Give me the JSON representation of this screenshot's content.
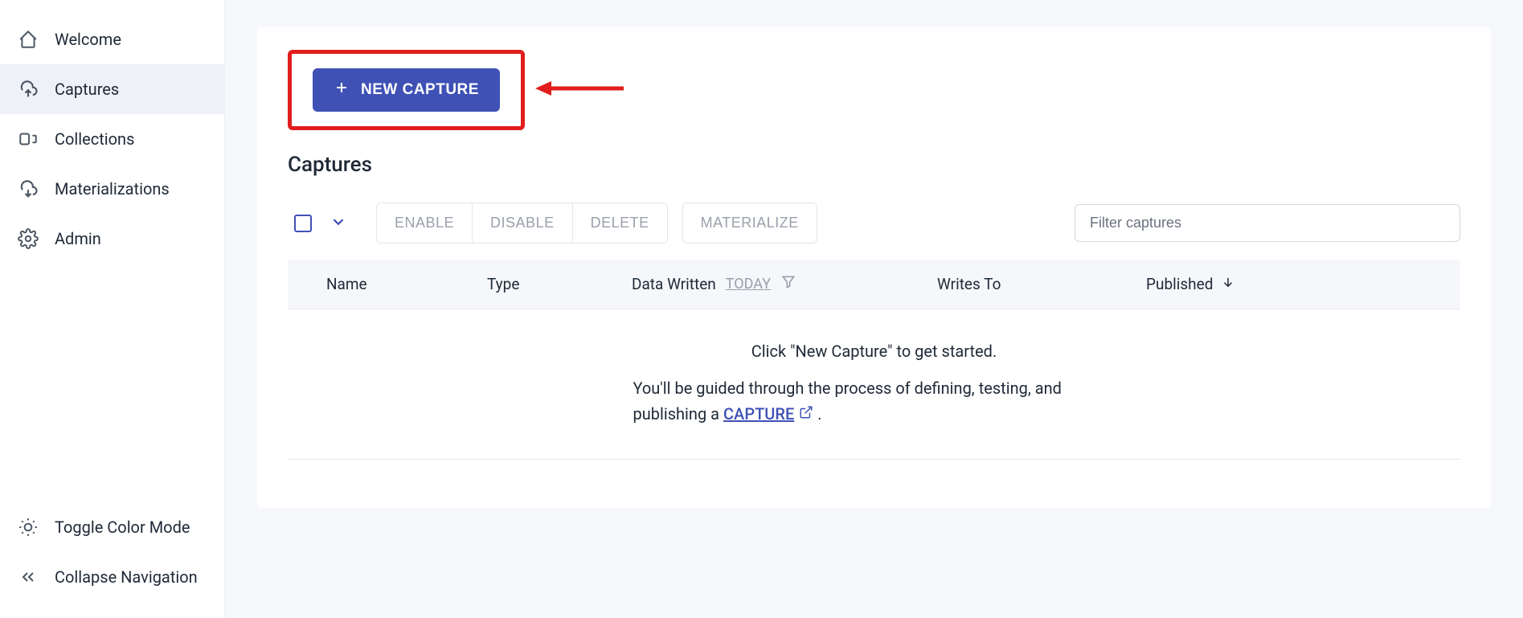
{
  "sidebar": {
    "items": [
      {
        "label": "Welcome"
      },
      {
        "label": "Captures"
      },
      {
        "label": "Collections"
      },
      {
        "label": "Materializations"
      },
      {
        "label": "Admin"
      }
    ],
    "bottom": [
      {
        "label": "Toggle Color Mode"
      },
      {
        "label": "Collapse Navigation"
      }
    ]
  },
  "header": {
    "new_capture_label": "NEW CAPTURE"
  },
  "page": {
    "title": "Captures"
  },
  "toolbar": {
    "enable": "ENABLE",
    "disable": "DISABLE",
    "delete": "DELETE",
    "materialize": "MATERIALIZE",
    "filter_placeholder": "Filter captures"
  },
  "table": {
    "cols": {
      "name": "Name",
      "type": "Type",
      "data_written": "Data Written",
      "today": "TODAY",
      "writes_to": "Writes To",
      "published": "Published"
    }
  },
  "empty": {
    "title": "Click \"New Capture\" to get started.",
    "desc1": "You'll be guided through the process of defining, testing, and publishing a ",
    "link": "CAPTURE",
    "desc2": " ."
  }
}
